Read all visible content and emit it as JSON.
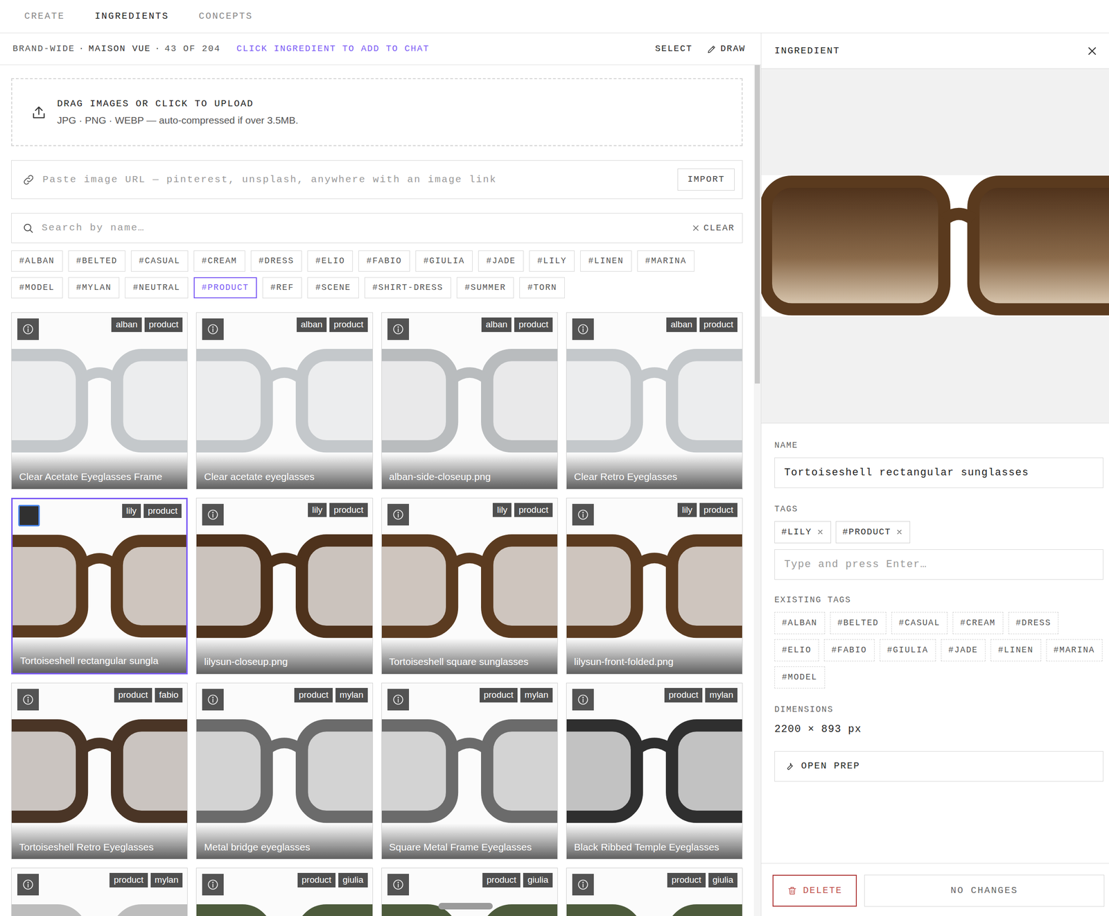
{
  "nav": {
    "tabs": [
      {
        "label": "CREATE",
        "selected": false
      },
      {
        "label": "INGREDIENTS",
        "selected": true
      },
      {
        "label": "CONCEPTS",
        "selected": false
      }
    ]
  },
  "library": {
    "breadcrumb": [
      "BRAND-WIDE",
      "·",
      "MAISON VUE",
      "·",
      "43 OF 204"
    ],
    "hint": "CLICK INGREDIENT TO ADD TO CHAT",
    "actions": [
      "SELECT",
      "DRAW"
    ],
    "upload": {
      "title": "DRAG IMAGES OR CLICK TO UPLOAD",
      "subtitle": "JPG · PNG · WEBP — auto-compressed if over 3.5MB."
    },
    "url_import": {
      "placeholder": "Paste image URL — pinterest, unsplash, anywhere with an image link",
      "button": "IMPORT"
    },
    "search": {
      "placeholder": "Search by name…",
      "clear": "CLEAR"
    },
    "tag_filters": [
      {
        "label": "#ALBAN",
        "selected": false
      },
      {
        "label": "#BELTED",
        "selected": false
      },
      {
        "label": "#CASUAL",
        "selected": false
      },
      {
        "label": "#CREAM",
        "selected": false
      },
      {
        "label": "#DRESS",
        "selected": false
      },
      {
        "label": "#ELIO",
        "selected": false
      },
      {
        "label": "#FABIO",
        "selected": false
      },
      {
        "label": "#GIULIA",
        "selected": false
      },
      {
        "label": "#JADE",
        "selected": false
      },
      {
        "label": "#LILY",
        "selected": false
      },
      {
        "label": "#LINEN",
        "selected": false
      },
      {
        "label": "#MARINA",
        "selected": false
      },
      {
        "label": "#MODEL",
        "selected": false
      },
      {
        "label": "#MYLAN",
        "selected": false
      },
      {
        "label": "#NEUTRAL",
        "selected": false
      },
      {
        "label": "#PRODUCT",
        "selected": true
      },
      {
        "label": "#REF",
        "selected": false
      },
      {
        "label": "#SCENE",
        "selected": false
      },
      {
        "label": "#SHIRT-DRESS",
        "selected": false
      },
      {
        "label": "#SUMMER",
        "selected": false
      },
      {
        "label": "#TORN",
        "selected": false
      }
    ],
    "items": [
      {
        "name": "Clear Acetate Eyeglasses Frame",
        "tags": [
          "alban",
          "product"
        ],
        "selected": false,
        "color": "#c4c8cb"
      },
      {
        "name": "Clear acetate eyeglasses",
        "tags": [
          "alban",
          "product"
        ],
        "selected": false,
        "color": "#c4c8cb"
      },
      {
        "name": "alban-side-closeup.png",
        "tags": [
          "alban",
          "product"
        ],
        "selected": false,
        "color": "#b9bcbe"
      },
      {
        "name": "Clear Retro Eyeglasses",
        "tags": [
          "alban",
          "product"
        ],
        "selected": false,
        "color": "#c4c8cb"
      },
      {
        "name": "Tortoiseshell rectangular sungla",
        "tags": [
          "lily",
          "product"
        ],
        "selected": true,
        "color": "#5b3b20"
      },
      {
        "name": "lilysun-closeup.png",
        "tags": [
          "lily",
          "product"
        ],
        "selected": false,
        "color": "#4e321c"
      },
      {
        "name": "Tortoiseshell square sunglasses",
        "tags": [
          "lily",
          "product"
        ],
        "selected": false,
        "color": "#5b3b20"
      },
      {
        "name": "lilysun-front-folded.png",
        "tags": [
          "lily",
          "product"
        ],
        "selected": false,
        "color": "#5b3b20"
      },
      {
        "name": "Tortoiseshell Retro Eyeglasses",
        "tags": [
          "product",
          "fabio"
        ],
        "selected": false,
        "color": "#4a3526"
      },
      {
        "name": "Metal bridge eyeglasses",
        "tags": [
          "product",
          "mylan"
        ],
        "selected": false,
        "color": "#6b6b6b"
      },
      {
        "name": "Square Metal Frame Eyeglasses",
        "tags": [
          "product",
          "mylan"
        ],
        "selected": false,
        "color": "#6b6b6b"
      },
      {
        "name": "Black Ribbed Temple Eyeglasses",
        "tags": [
          "product",
          "mylan"
        ],
        "selected": false,
        "color": "#2f2f2f"
      },
      {
        "tags": [
          "product",
          "mylan"
        ],
        "selected": false,
        "color": "#bdbdbd"
      },
      {
        "tags": [
          "product",
          "giulia"
        ],
        "selected": false,
        "color": "#4d5b3c"
      },
      {
        "tags": [
          "product",
          "giulia"
        ],
        "selected": false,
        "color": "#4d5b3c"
      },
      {
        "tags": [
          "product",
          "giulia"
        ],
        "selected": false,
        "color": "#4d5b3c"
      }
    ]
  },
  "detail": {
    "title": "INGREDIENT",
    "name_label": "NAME",
    "name": "Tortoiseshell rectangular sunglasses",
    "tags_label": "TAGS",
    "tags": [
      "#LILY",
      "#PRODUCT"
    ],
    "tag_input_placeholder": "Type and press Enter…",
    "existing_label": "EXISTING TAGS",
    "existing_tags": [
      "#ALBAN",
      "#BELTED",
      "#CASUAL",
      "#CREAM",
      "#DRESS",
      "#ELIO",
      "#FABIO",
      "#GIULIA",
      "#JADE",
      "#LINEN",
      "#MARINA",
      "#MODEL"
    ],
    "dimensions_label": "DIMENSIONS",
    "dimensions": "2200 × 893 px",
    "prep_button": "OPEN PREP",
    "delete_button": "DELETE",
    "save_button": {
      "label": "NO CHANGES",
      "disabled": true
    }
  }
}
